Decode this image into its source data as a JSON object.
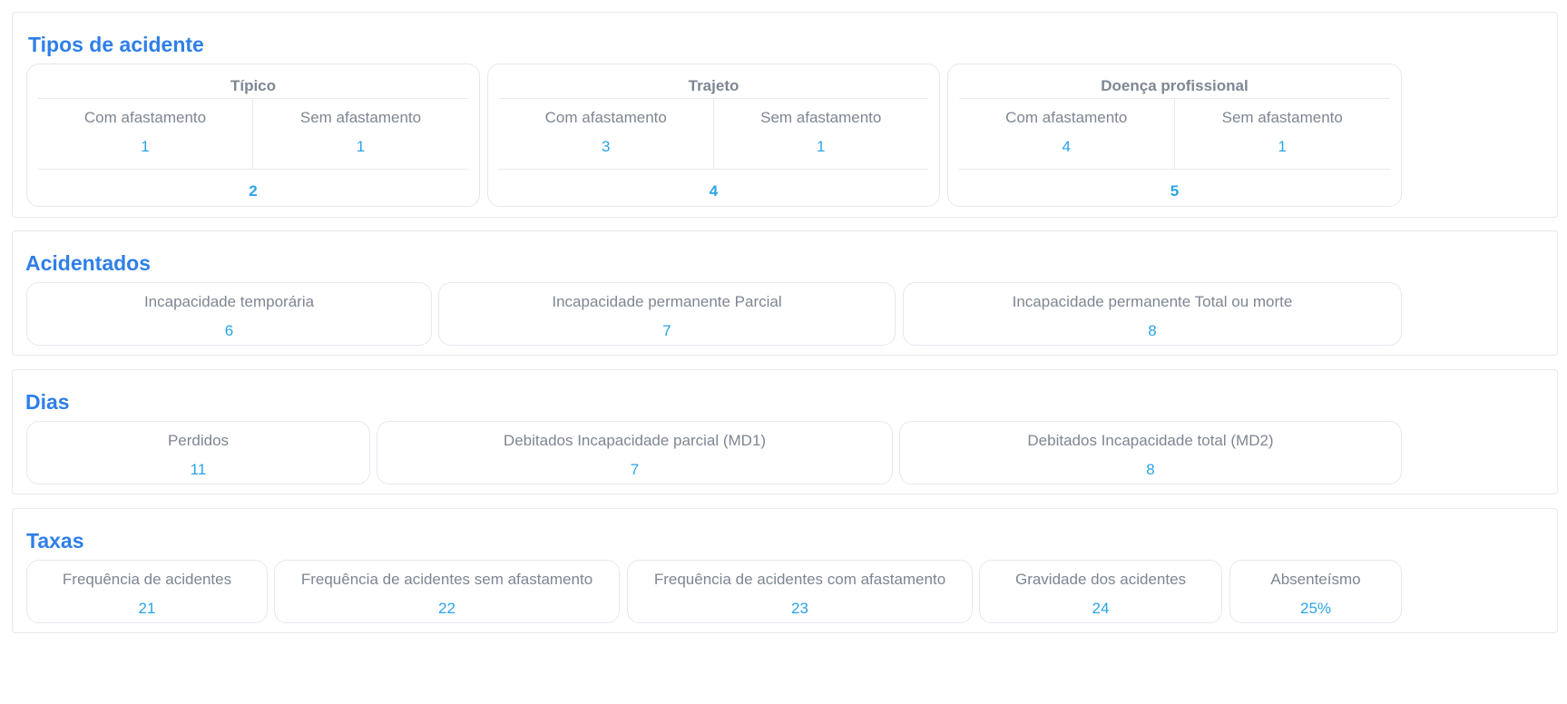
{
  "tipos": {
    "title": "Tipos de acidente",
    "typical": {
      "header": "Típico",
      "left_label": "Com afastamento",
      "left_value": "1",
      "right_label": "Sem afastamento",
      "right_value": "1",
      "total": "2"
    },
    "commute": {
      "header": "Trajeto",
      "left_label": "Com afastamento",
      "left_value": "3",
      "right_label": "Sem afastamento",
      "right_value": "1",
      "total": "4"
    },
    "disease": {
      "header": "Doença profissional",
      "left_label": "Com afastamento",
      "left_value": "4",
      "right_label": "Sem afastamento",
      "right_value": "1",
      "total": "5"
    }
  },
  "acidentados": {
    "title": "Acidentados",
    "items": [
      {
        "label": "Incapacidade temporária",
        "value": "6"
      },
      {
        "label": "Incapacidade permanente Parcial",
        "value": "7"
      },
      {
        "label": "Incapacidade permanente Total ou morte",
        "value": "8"
      }
    ]
  },
  "dias": {
    "title": "Dias",
    "items": [
      {
        "label": "Perdidos",
        "value": "11"
      },
      {
        "label": "Debitados Incapacidade parcial (MD1)",
        "value": "7"
      },
      {
        "label": "Debitados Incapacidade total (MD2)",
        "value": "8"
      }
    ]
  },
  "taxas": {
    "title": "Taxas",
    "items": [
      {
        "label": "Frequência de acidentes",
        "value": "21"
      },
      {
        "label": "Frequência de acidentes sem afastamento",
        "value": "22"
      },
      {
        "label": "Frequência de acidentes com afastamento",
        "value": "23"
      },
      {
        "label": "Gravidade dos acidentes",
        "value": "24"
      },
      {
        "label": "Absenteísmo",
        "value": "25%"
      }
    ]
  },
  "colors": {
    "title": "#2f7fe8",
    "value": "#2aa3e8",
    "label": "#7e8693",
    "border": "#e4e8ee"
  }
}
